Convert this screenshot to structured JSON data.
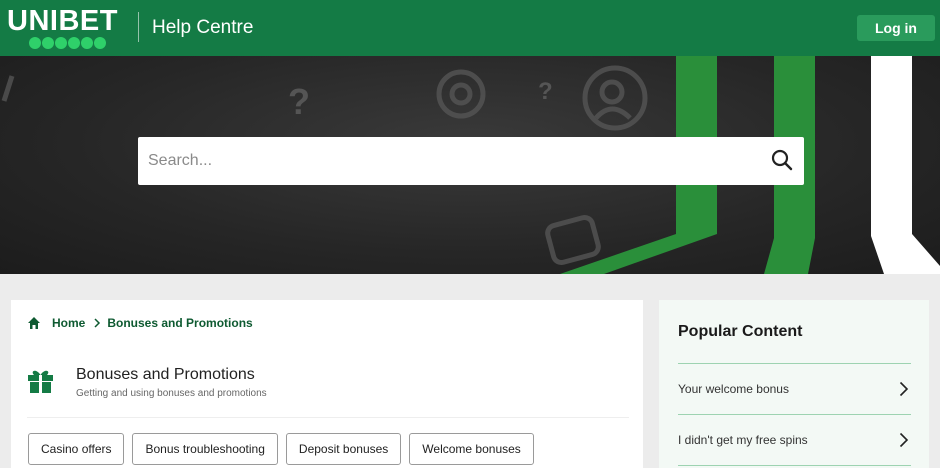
{
  "header": {
    "logo_text": "UNIBET",
    "title": "Help Centre",
    "login_label": "Log in"
  },
  "search": {
    "placeholder": "Search..."
  },
  "breadcrumb": {
    "home": "Home",
    "current": "Bonuses and Promotions"
  },
  "section": {
    "title": "Bonuses and Promotions",
    "subtitle": "Getting and using bonuses and promotions",
    "icon": "gift-icon"
  },
  "categories": [
    {
      "label": "Casino offers"
    },
    {
      "label": "Bonus troubleshooting"
    },
    {
      "label": "Deposit bonuses"
    },
    {
      "label": "Welcome bonuses"
    }
  ],
  "popular": {
    "title": "Popular Content",
    "items": [
      {
        "label": "Your welcome bonus"
      },
      {
        "label": "I didn't get my free spins"
      }
    ]
  },
  "colors": {
    "brand_green": "#147b45",
    "accent_green": "#2fd06a",
    "link_green": "#0e5a31"
  }
}
